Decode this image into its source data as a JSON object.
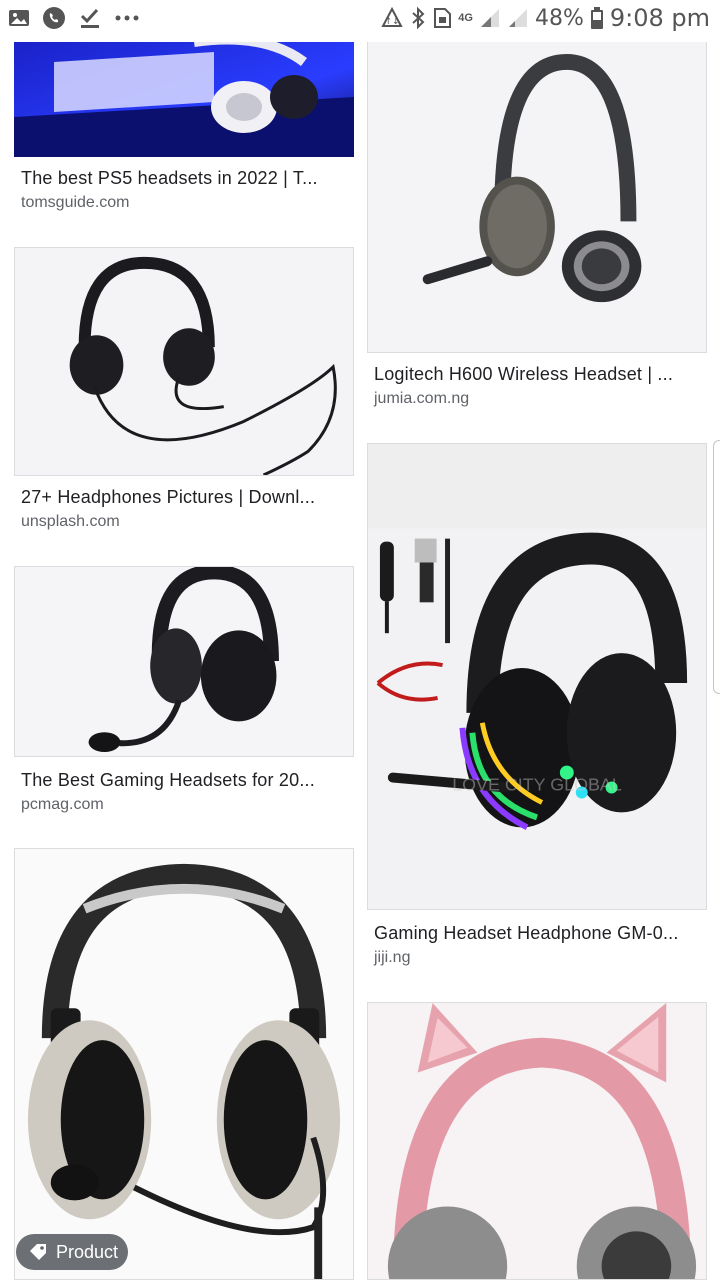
{
  "status_bar": {
    "battery": "48%",
    "time": "9:08 pm",
    "network": "4G",
    "left_icons": [
      "image-icon",
      "whatsapp-icon",
      "check-icon",
      "more-icon"
    ],
    "right_icons": [
      "data-saver-icon",
      "bluetooth-icon",
      "sim-icon",
      "signal-icon",
      "signal-icon-2",
      "battery-icon"
    ]
  },
  "results": [
    {
      "title": "The best PS5 headsets in 2022 | T...",
      "source": "tomsguide.com"
    },
    {
      "title": "Logitech H600 Wireless Headset | ...",
      "source": "jumia.com.ng"
    },
    {
      "title": "27+ Headphones Pictures | Downl...",
      "source": "unsplash.com"
    },
    {
      "title": "Gaming Headset Headphone GM-0...",
      "source": "jiji.ng"
    },
    {
      "title": "The Best Gaming Headsets for 20...",
      "source": "pcmag.com"
    },
    {
      "title": "",
      "source": ""
    },
    {
      "title": "",
      "source": ""
    }
  ],
  "chip": {
    "label": "Product",
    "icon": "tag-icon"
  },
  "watermark": "LOVE CITY GLOBAL"
}
